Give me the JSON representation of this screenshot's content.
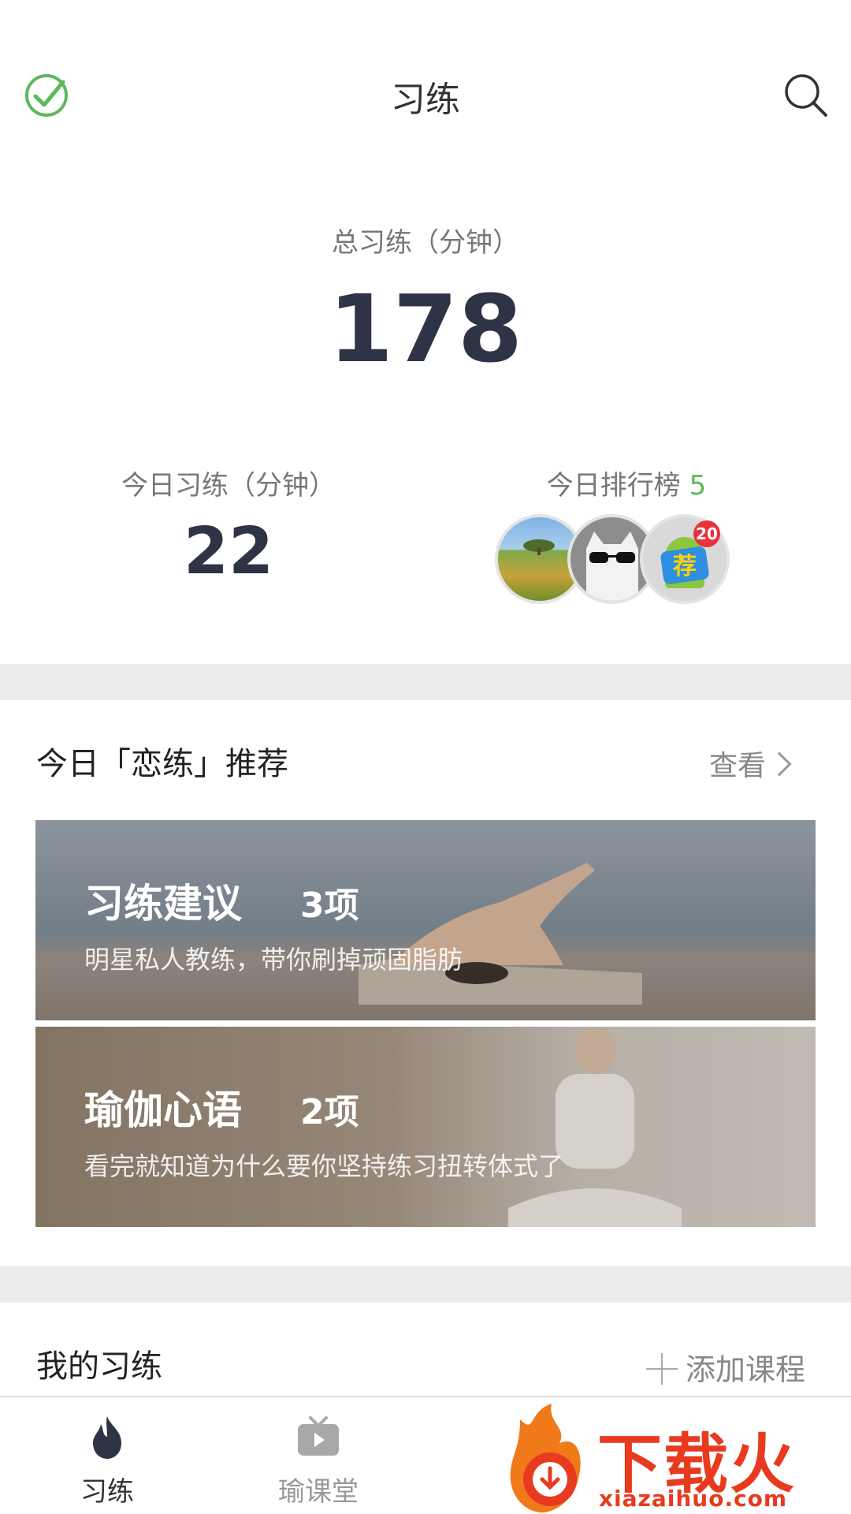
{
  "header": {
    "title": "习练"
  },
  "summary": {
    "total_label": "总习练（分钟）",
    "total_value": "178",
    "today_label": "今日习练（分钟）",
    "today_value": "22",
    "rank_label": "今日排行榜",
    "rank_count": "5",
    "avatar_badge": "20"
  },
  "recommend": {
    "title": "今日「恋练」推荐",
    "more_label": "查看",
    "cards": [
      {
        "title": "习练建议",
        "count": "3项",
        "desc": "明星私人教练，带你刷掉顽固脂肪"
      },
      {
        "title": "瑜伽心语",
        "count": "2项",
        "desc": "看完就知道为什么要你坚持练习扭转体式了"
      }
    ]
  },
  "mine": {
    "title": "我的习练",
    "add_label": "添加课程"
  },
  "tabbar": {
    "tabs": [
      {
        "label": "习练"
      },
      {
        "label": "瑜课堂"
      }
    ]
  },
  "watermark": {
    "text": "下载火",
    "sub": "xiazaihuo.com"
  },
  "colors": {
    "accent_green": "#5cb85c",
    "number_dark": "#2e3345",
    "badge_red": "#e8323c",
    "watermark_red": "#e83a1f"
  },
  "icons": {
    "header_left": "check-circle-icon",
    "header_right": "search-icon",
    "tab1": "flame-icon",
    "tab2": "tv-icon"
  }
}
